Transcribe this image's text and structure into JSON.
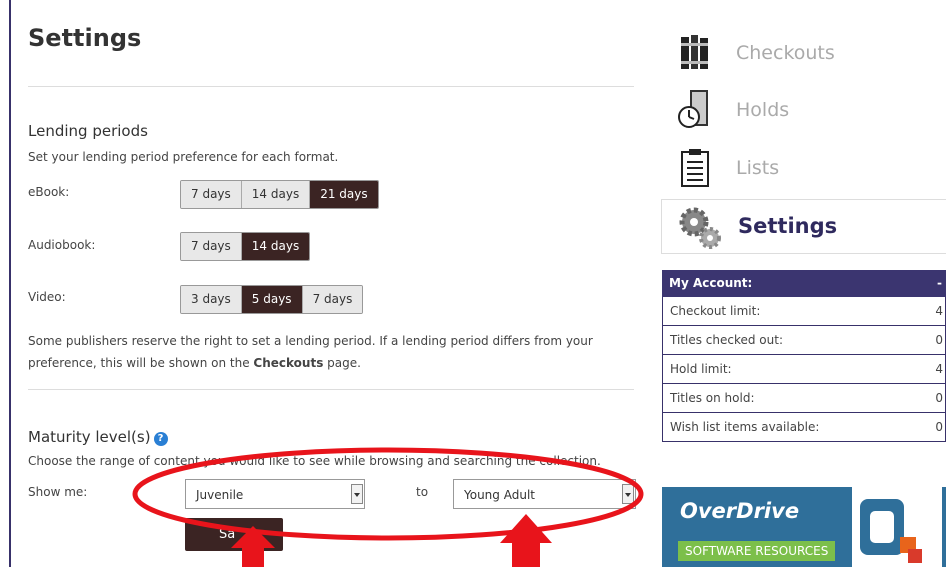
{
  "page": {
    "title": "Settings"
  },
  "lending": {
    "heading": "Lending periods",
    "description": "Set your lending period preference for each format.",
    "ebook": {
      "label": "eBook:",
      "options": [
        "7 days",
        "14 days",
        "21 days"
      ],
      "selected": "21 days"
    },
    "audiobook": {
      "label": "Audiobook:",
      "options": [
        "7 days",
        "14 days"
      ],
      "selected": "14 days"
    },
    "video": {
      "label": "Video:",
      "options": [
        "3 days",
        "5 days",
        "7 days"
      ],
      "selected": "5 days"
    },
    "note_line1": "Some publishers reserve the right to set a lending period. If a lending period differs from your",
    "note_line2_pre": "preference, this will be shown on the ",
    "note_link": "Checkouts",
    "note_line2_post": " page."
  },
  "maturity": {
    "heading": "Maturity level(s)",
    "description": "Choose the range of content you would like to see while browsing and searching the collection.",
    "show_me_label": "Show me:",
    "from_value": "Juvenile",
    "to_label": "to",
    "to_value": "Young Adult",
    "save_label": "Sa"
  },
  "nav": {
    "checkouts": "Checkouts",
    "holds": "Holds",
    "lists": "Lists",
    "settings": "Settings"
  },
  "account": {
    "header": "My Account:",
    "header_toggle": "-",
    "rows": [
      {
        "label": "Checkout limit:",
        "value": "4"
      },
      {
        "label": "Titles checked out:",
        "value": "0"
      },
      {
        "label": "Hold limit:",
        "value": "4"
      },
      {
        "label": "Titles on hold:",
        "value": "0"
      },
      {
        "label": "Wish list items available:",
        "value": "0"
      }
    ]
  },
  "banner": {
    "brand": "OverDrive",
    "tagline": "SOFTWARE RESOURCES"
  },
  "colors": {
    "accent": "#3b2423",
    "nav_dark": "#2f2a5e",
    "annotation": "#e8141b"
  }
}
